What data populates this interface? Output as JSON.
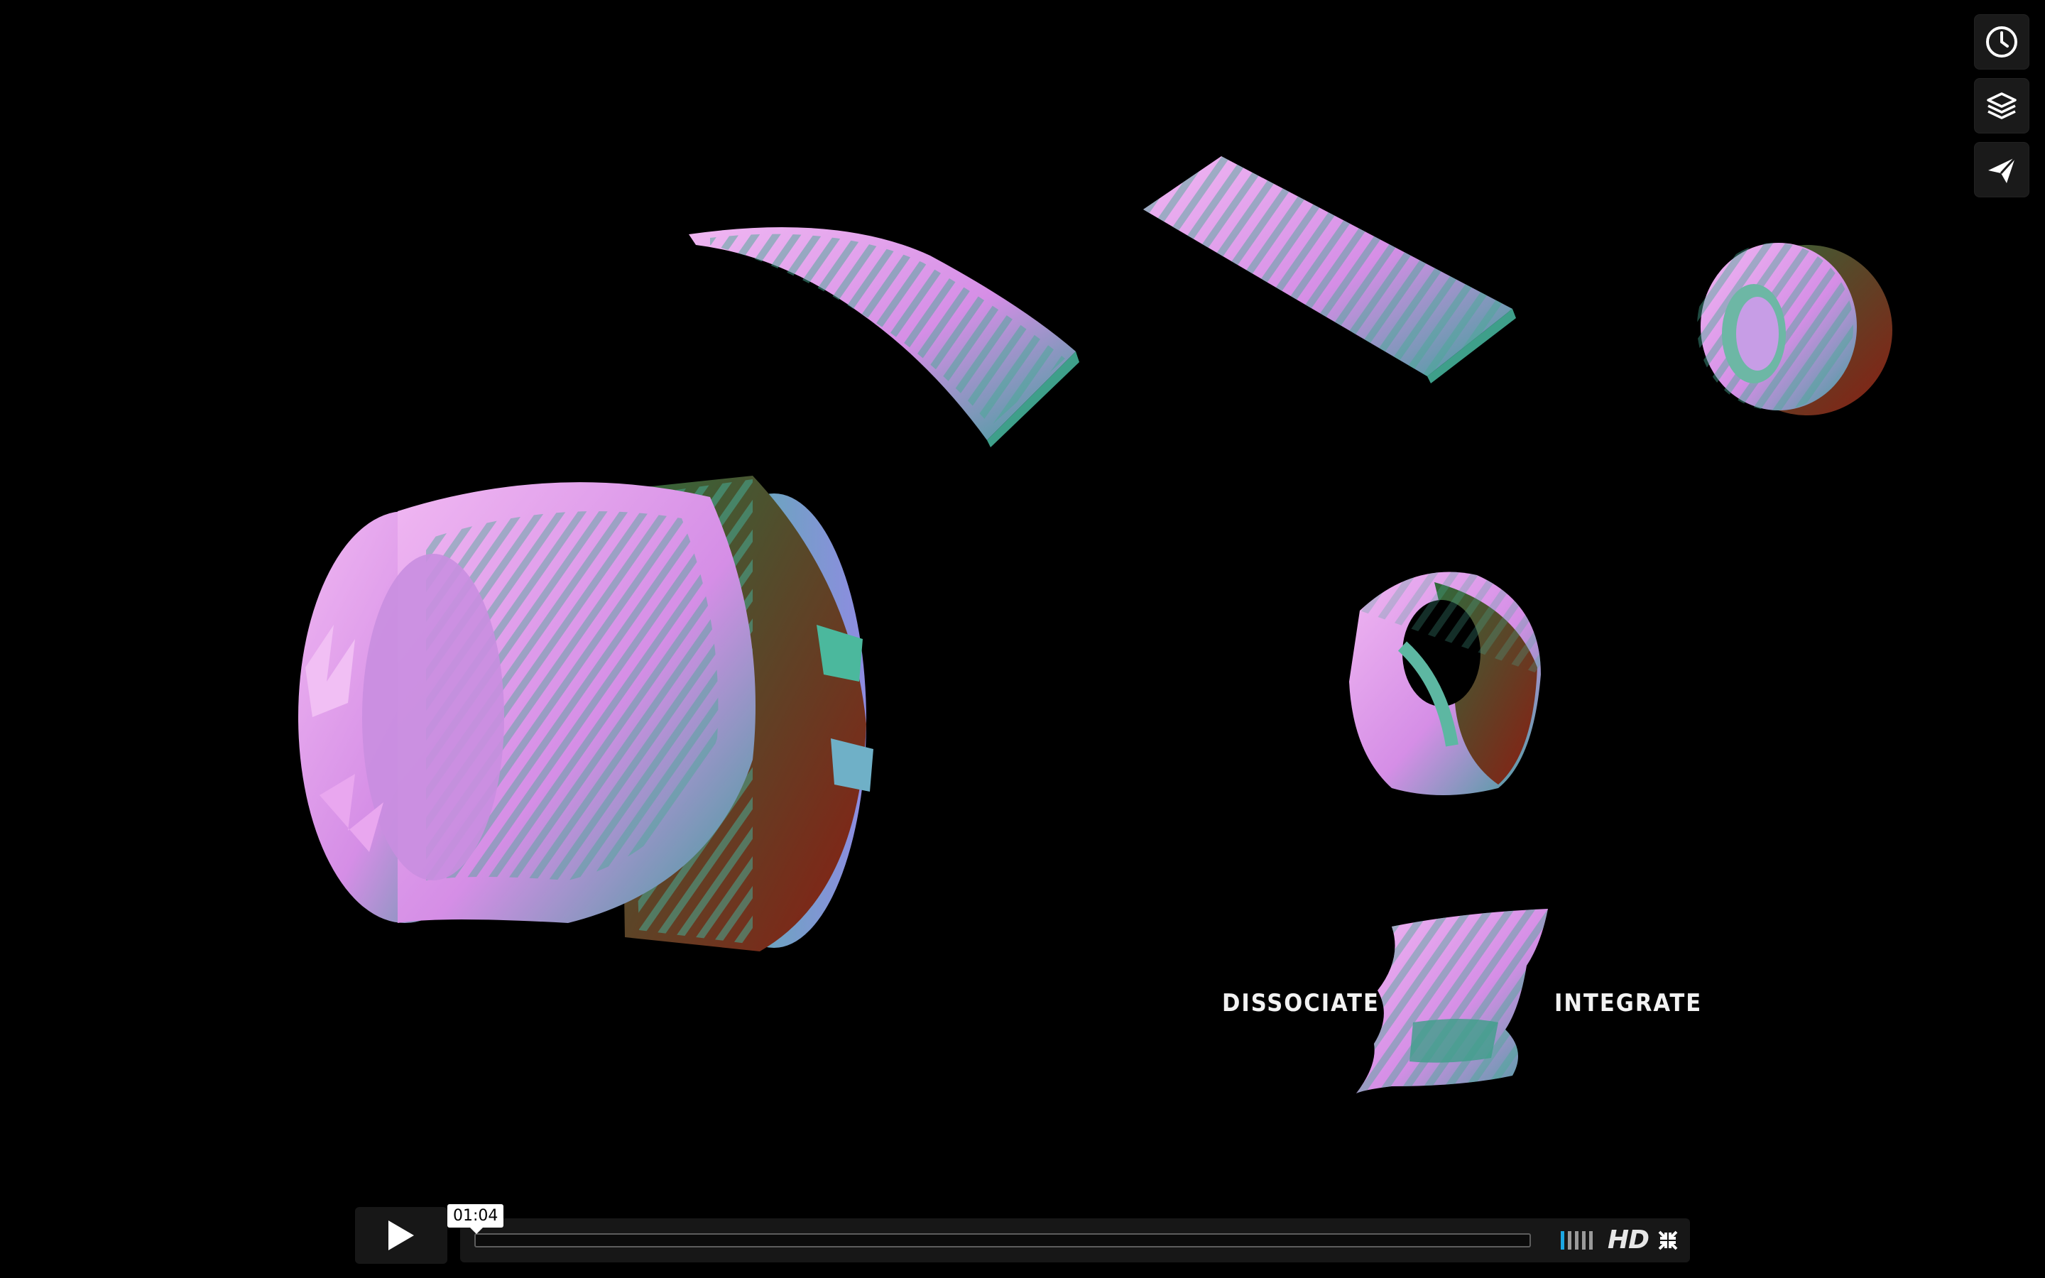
{
  "player": {
    "current_time": "01:04",
    "progress_fraction": 0.0,
    "volume_level": "1/5",
    "hd_label": "HD"
  },
  "video_frame": {
    "left_caption": "DISSOCIATE",
    "right_caption": "INTEGRATE"
  },
  "side_actions": [
    {
      "icon": "clock-icon"
    },
    {
      "icon": "layers-icon"
    },
    {
      "icon": "send-icon"
    }
  ],
  "colors": {
    "accent": "#1ba6e2",
    "bar_bg": "#171717",
    "sculpture_pink": "#e9a6f0",
    "sculpture_teal": "#3aa596",
    "sculpture_red": "#8b1c10"
  }
}
